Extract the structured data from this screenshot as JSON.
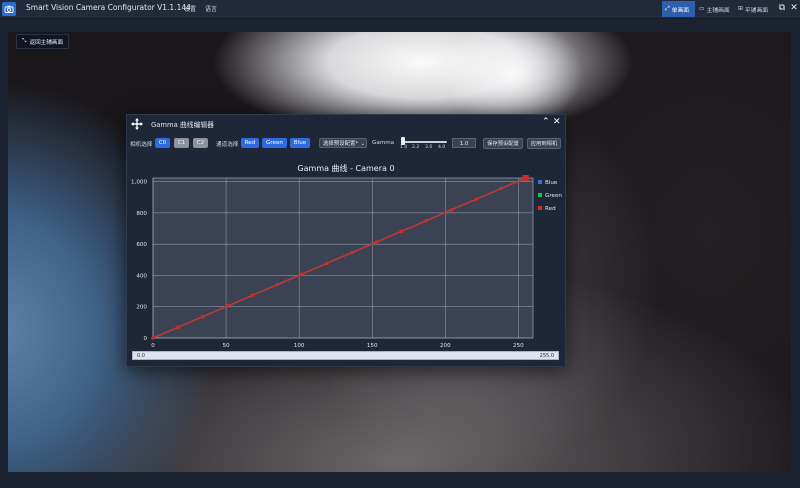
{
  "app": {
    "title": "Smart Vision Camera Configurator V1.1.144",
    "menus": [
      "设置",
      "语言"
    ],
    "views": [
      {
        "label": "单画面",
        "active": true
      },
      {
        "label": "主辅画面",
        "active": false
      },
      {
        "label": "平铺画面",
        "active": false
      }
    ]
  },
  "viewport": {
    "back_label": "返回主辅画面"
  },
  "dialog": {
    "title": "Gamma 曲线编辑器",
    "camera_select_label": "相机选择",
    "cameras": [
      {
        "label": "C0",
        "active": true
      },
      {
        "label": "C1",
        "active": false
      },
      {
        "label": "C2",
        "active": false
      }
    ],
    "channel_select_label": "通道选择",
    "channels": [
      "Red",
      "Green",
      "Blue"
    ],
    "preset_dropdown": "选择预设配置*",
    "gamma_label": "Gamma",
    "gamma_ticks": [
      "1.0",
      "2.2",
      "3.0",
      "4.0"
    ],
    "gamma_value": "1.0",
    "gamma_slider_value": 1.0,
    "gamma_slider_range": [
      1.0,
      4.0
    ],
    "save_preset": "保存预设配置",
    "apply_camera": "应用到相机",
    "range_min": "0.0",
    "range_max": "255.0"
  },
  "chart_data": {
    "type": "line",
    "title": "Gamma 曲线 - Camera 0",
    "xlabel": "",
    "ylabel": "",
    "xlim": [
      0,
      260
    ],
    "ylim": [
      0,
      1023
    ],
    "x_ticks": [
      "0",
      "50",
      "100",
      "150",
      "200",
      "250"
    ],
    "x_tick_values": [
      0,
      50,
      100,
      150,
      200,
      250
    ],
    "y_ticks": [
      "0",
      "200",
      "400",
      "600",
      "800",
      "1,000"
    ],
    "y_tick_values": [
      0,
      200,
      400,
      600,
      800,
      1000
    ],
    "grid": true,
    "legend_position": "right",
    "series": [
      {
        "name": "Blue",
        "color": "#3a6fd8",
        "x": [
          0,
          255
        ],
        "y": [
          0,
          1023
        ]
      },
      {
        "name": "Green",
        "color": "#2fb84a",
        "x": [
          0,
          255
        ],
        "y": [
          0,
          1023
        ]
      },
      {
        "name": "Red",
        "color": "#d22a2a",
        "x": [
          0,
          255
        ],
        "y": [
          0,
          1023
        ]
      }
    ],
    "control_points": {
      "x": [
        0,
        17,
        34,
        51,
        68,
        85,
        102,
        119,
        136,
        153,
        170,
        187,
        204,
        221,
        238,
        255
      ],
      "y": [
        0,
        68,
        136,
        205,
        273,
        341,
        409,
        477,
        545,
        614,
        682,
        750,
        818,
        886,
        955,
        1023
      ]
    }
  }
}
